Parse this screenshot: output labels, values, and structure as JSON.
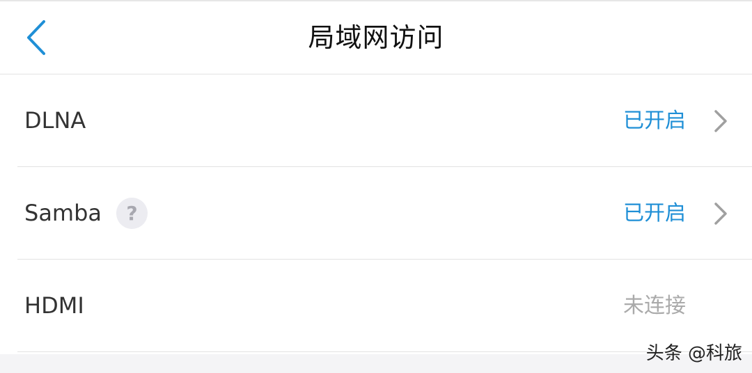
{
  "header": {
    "title": "局域网访问",
    "back_icon": "chevron-left-icon"
  },
  "colors": {
    "accent": "#1f8fd6",
    "status_inactive": "#aaaaaa",
    "chevron": "#a0a0a0",
    "divider": "#e2e2e2"
  },
  "rows": [
    {
      "label": "DLNA",
      "status": "已开启",
      "status_type": "on",
      "has_chevron": true,
      "has_help": false
    },
    {
      "label": "Samba",
      "status": "已开启",
      "status_type": "on",
      "has_chevron": true,
      "has_help": true,
      "help_glyph": "?"
    },
    {
      "label": "HDMI",
      "status": "未连接",
      "status_type": "off",
      "has_chevron": false,
      "has_help": false
    }
  ],
  "watermark": "头条 @科旅"
}
